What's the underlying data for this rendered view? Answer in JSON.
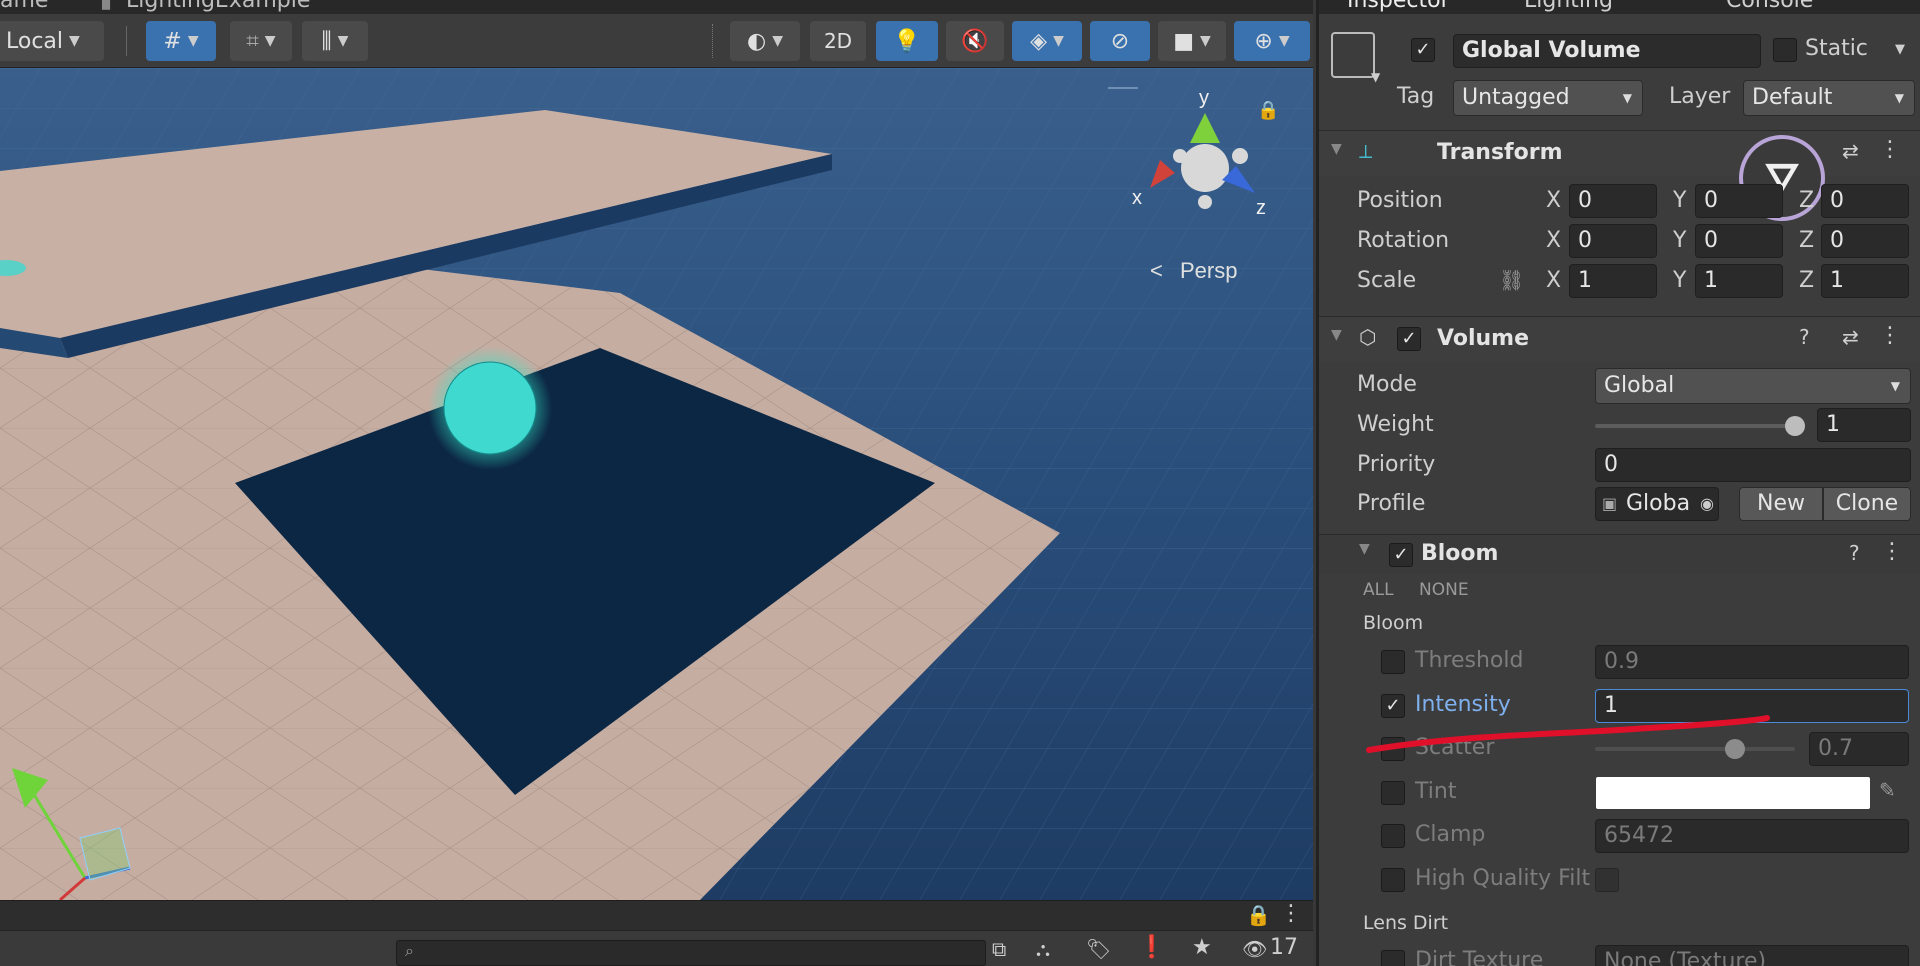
{
  "scene": {
    "tabs": [
      {
        "label": "ame"
      },
      {
        "label": "LightingExample"
      }
    ],
    "toolbar": {
      "pivot_mode": "Local",
      "view_2d": "2D",
      "persp_label": "Persp",
      "axis_x": "x",
      "axis_y": "y",
      "axis_z": "z"
    },
    "bottom": {
      "search_placeholder": "",
      "visible_count": "17"
    }
  },
  "inspector": {
    "tabs": [
      {
        "label": "Inspector"
      },
      {
        "label": "Lighting"
      },
      {
        "label": "Console"
      }
    ],
    "object": {
      "name": "Global Volume",
      "active": true,
      "static_label": "Static",
      "static": false,
      "tag_label": "Tag",
      "tag_value": "Untagged",
      "layer_label": "Layer",
      "layer_value": "Default"
    },
    "transform": {
      "title": "Transform",
      "position_label": "Position",
      "rotation_label": "Rotation",
      "scale_label": "Scale",
      "position": {
        "x": "0",
        "y": "0",
        "z": "0"
      },
      "rotation": {
        "x": "0",
        "y": "0",
        "z": "0"
      },
      "scale": {
        "x": "1",
        "y": "1",
        "z": "1"
      },
      "axis_x": "X",
      "axis_y": "Y",
      "axis_z": "Z"
    },
    "volume": {
      "title": "Volume",
      "mode_label": "Mode",
      "mode_value": "Global",
      "weight_label": "Weight",
      "weight_value": "1",
      "weight_fraction": 1.0,
      "priority_label": "Priority",
      "priority_value": "0",
      "profile_label": "Profile",
      "profile_value": "Globa",
      "new_label": "New",
      "clone_label": "Clone"
    },
    "bloom": {
      "title": "Bloom",
      "all_label": "ALL",
      "none_label": "NONE",
      "section_label": "Bloom",
      "threshold_label": "Threshold",
      "threshold_value": "0.9",
      "intensity_label": "Intensity",
      "intensity_value": "1",
      "scatter_label": "Scatter",
      "scatter_value": "0.7",
      "scatter_fraction": 0.7,
      "tint_label": "Tint",
      "tint_color": "#ffffff",
      "clamp_label": "Clamp",
      "clamp_value": "65472",
      "hq_label": "High Quality Filt",
      "lens_dirt_label": "Lens Dirt",
      "dirt_texture_label": "Dirt Texture",
      "dirt_texture_value": "None (Texture)"
    }
  },
  "colors": {
    "accent_blue": "#3a72b0",
    "annotation_red": "#e0102a",
    "sphere_glow": "#35e6c8",
    "floor": "#c9b1a6",
    "sky": "#2f5582"
  }
}
